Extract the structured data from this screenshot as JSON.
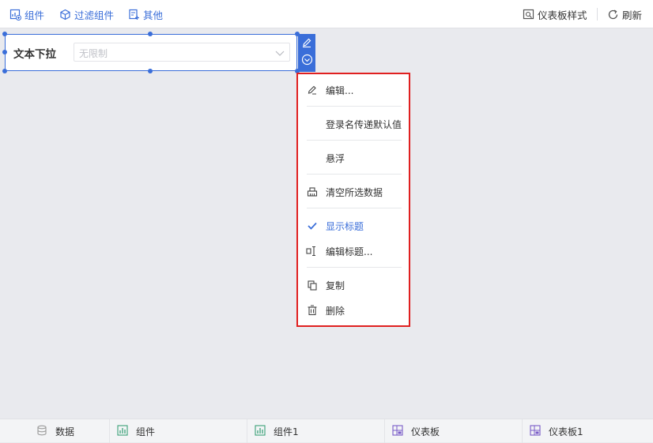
{
  "toolbar": {
    "left": [
      {
        "label": "组件",
        "icon": "chart-add-icon"
      },
      {
        "label": "过滤组件",
        "icon": "cube-icon"
      },
      {
        "label": "其他",
        "icon": "doc-add-icon"
      }
    ],
    "right": [
      {
        "label": "仪表板样式",
        "icon": "style-icon"
      },
      {
        "label": "刷新",
        "icon": "refresh-icon"
      }
    ]
  },
  "widget": {
    "title": "文本下拉",
    "select_placeholder": "无限制"
  },
  "context_menu": {
    "items": [
      {
        "label": "编辑...",
        "icon": "pencil-icon"
      },
      {
        "label": "登录名传递默认值",
        "icon": ""
      },
      {
        "label": "悬浮",
        "icon": ""
      },
      {
        "label": "清空所选数据",
        "icon": "eraser-icon"
      },
      {
        "label": "显示标题",
        "icon": "check-icon",
        "checked": true
      },
      {
        "label": "编辑标题...",
        "icon": "text-cursor-icon"
      },
      {
        "label": "复制",
        "icon": "copy-icon"
      },
      {
        "label": "删除",
        "icon": "trash-icon"
      }
    ]
  },
  "bottom_tabs": [
    {
      "label": "数据",
      "icon": "database-icon"
    },
    {
      "label": "组件",
      "icon": "bar-chart-icon"
    },
    {
      "label": "组件1",
      "icon": "bar-chart-icon"
    },
    {
      "label": "仪表板",
      "icon": "dashboard-icon"
    },
    {
      "label": "仪表板1",
      "icon": "dashboard-icon"
    }
  ],
  "colors": {
    "accent": "#3a6ed9",
    "menu_highlight_border": "#e02020",
    "canvas_bg": "#e9eaee"
  }
}
